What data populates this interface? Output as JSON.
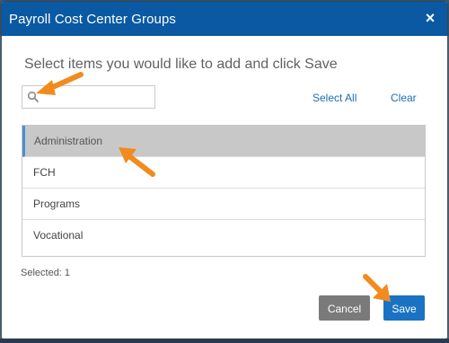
{
  "dialog": {
    "title": "Payroll Cost Center Groups",
    "close_glyph": "×",
    "instruction": "Select items you would like to add and click Save"
  },
  "search": {
    "value": "",
    "placeholder": ""
  },
  "actions": {
    "select_all": "Select All",
    "clear": "Clear"
  },
  "items": [
    {
      "label": "Administration",
      "selected": true
    },
    {
      "label": "FCH",
      "selected": false
    },
    {
      "label": "Programs",
      "selected": false
    },
    {
      "label": "Vocational",
      "selected": false
    }
  ],
  "selection_summary": "Selected: 1",
  "buttons": {
    "cancel": "Cancel",
    "save": "Save"
  },
  "colors": {
    "header": "#0a59a2",
    "accent": "#1a73c2",
    "selected_row": "#c8c8c8",
    "annotation_arrow": "#f28b1e"
  }
}
